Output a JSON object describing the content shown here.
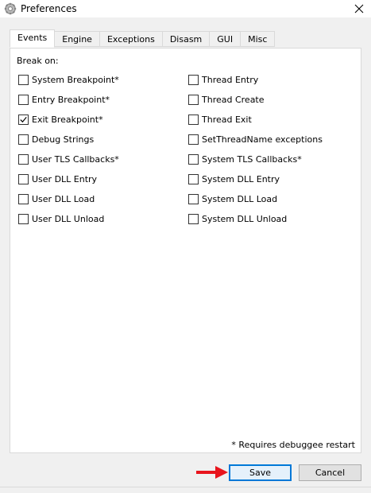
{
  "window": {
    "title": "Preferences",
    "close_glyph": "✕",
    "icon": "gear-icon"
  },
  "tabs": [
    {
      "label": "Events",
      "active": true
    },
    {
      "label": "Engine",
      "active": false
    },
    {
      "label": "Exceptions",
      "active": false
    },
    {
      "label": "Disasm",
      "active": false
    },
    {
      "label": "GUI",
      "active": false
    },
    {
      "label": "Misc",
      "active": false
    }
  ],
  "events": {
    "break_on_label": "Break on:",
    "left_column": [
      {
        "label": "System Breakpoint*",
        "checked": false
      },
      {
        "label": "Entry Breakpoint*",
        "checked": false
      },
      {
        "label": "Exit Breakpoint*",
        "checked": true
      },
      {
        "label": "Debug Strings",
        "checked": false
      },
      {
        "label": "User TLS Callbacks*",
        "checked": false
      },
      {
        "label": "User DLL Entry",
        "checked": false
      },
      {
        "label": "User DLL Load",
        "checked": false
      },
      {
        "label": "User DLL Unload",
        "checked": false
      }
    ],
    "right_column": [
      {
        "label": "Thread Entry",
        "checked": false
      },
      {
        "label": "Thread Create",
        "checked": false
      },
      {
        "label": "Thread Exit",
        "checked": false
      },
      {
        "label": "SetThreadName exceptions",
        "checked": false
      },
      {
        "label": "System TLS Callbacks*",
        "checked": false
      },
      {
        "label": "System DLL Entry",
        "checked": false
      },
      {
        "label": "System DLL Load",
        "checked": false
      },
      {
        "label": "System DLL Unload",
        "checked": false
      }
    ]
  },
  "footnote": "* Requires debuggee restart",
  "buttons": {
    "save_label": "Save",
    "cancel_label": "Cancel"
  },
  "colors": {
    "accent": "#0078d7",
    "arrow": "#e8141c",
    "window_bg": "#f0f0f0"
  }
}
